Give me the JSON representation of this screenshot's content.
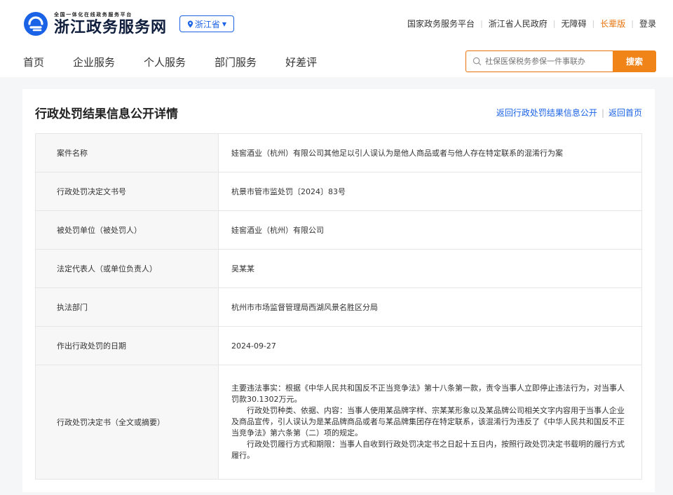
{
  "header": {
    "logo_sub": "全国一体化在线政务服务平台",
    "logo_main": "浙江政务服务网",
    "region": "浙江省",
    "top_links": [
      "国家政务服务平台",
      "浙江省人民政府",
      "无障碍",
      "长辈版",
      "登录"
    ],
    "colors": {
      "primary": "#1a62e6",
      "accent": "#f08419",
      "elder": "#e8730c"
    }
  },
  "nav": {
    "items": [
      "首页",
      "企业服务",
      "个人服务",
      "部门服务",
      "好差评"
    ]
  },
  "search": {
    "placeholder": "社保医保税务参保一件事联办",
    "button": "搜索"
  },
  "card": {
    "title": "行政处罚结果信息公开详情",
    "links": [
      "返回行政处罚结果信息公开",
      "返回首页"
    ],
    "rows": [
      {
        "label": "案件名称",
        "value": "娃窖酒业（杭州）有限公司其他足以引人误认为是他人商品或者与他人存在特定联系的混淆行为案"
      },
      {
        "label": "行政处罚决定文书号",
        "value": "杭景市管市监处罚〔2024〕83号"
      },
      {
        "label": "被处罚单位（被处罚人）",
        "value": "娃窖酒业（杭州）有限公司"
      },
      {
        "label": "法定代表人（或单位负责人）",
        "value": "吴某某"
      },
      {
        "label": "执法部门",
        "value": "杭州市市场监督管理局西湖风景名胜区分局"
      },
      {
        "label": "作出行政处罚的日期",
        "value": "2024-09-27"
      }
    ],
    "decision": {
      "label": "行政处罚决定书（全文或摘要）",
      "paragraphs": [
        "主要违法事实：根据《中华人民共和国反不正当竞争法》第十八条第一款，责令当事人立即停止违法行为，对当事人罚款30.1302万元。",
        "行政处罚种类、依据、内容：当事人使用某品牌字样、宗某某形象以及某品牌公司相关文字内容用于当事人企业及商品宣传，引人误认为是某品牌商品或者与某品牌集团存在特定联系，该混淆行为违反了《中华人民共和国反不正当竞争法》第六条第（二）项的规定。",
        "行政处罚履行方式和期限：当事人自收到行政处罚决定书之日起十五日内，按照行政处罚决定书载明的履行方式履行。"
      ]
    }
  }
}
